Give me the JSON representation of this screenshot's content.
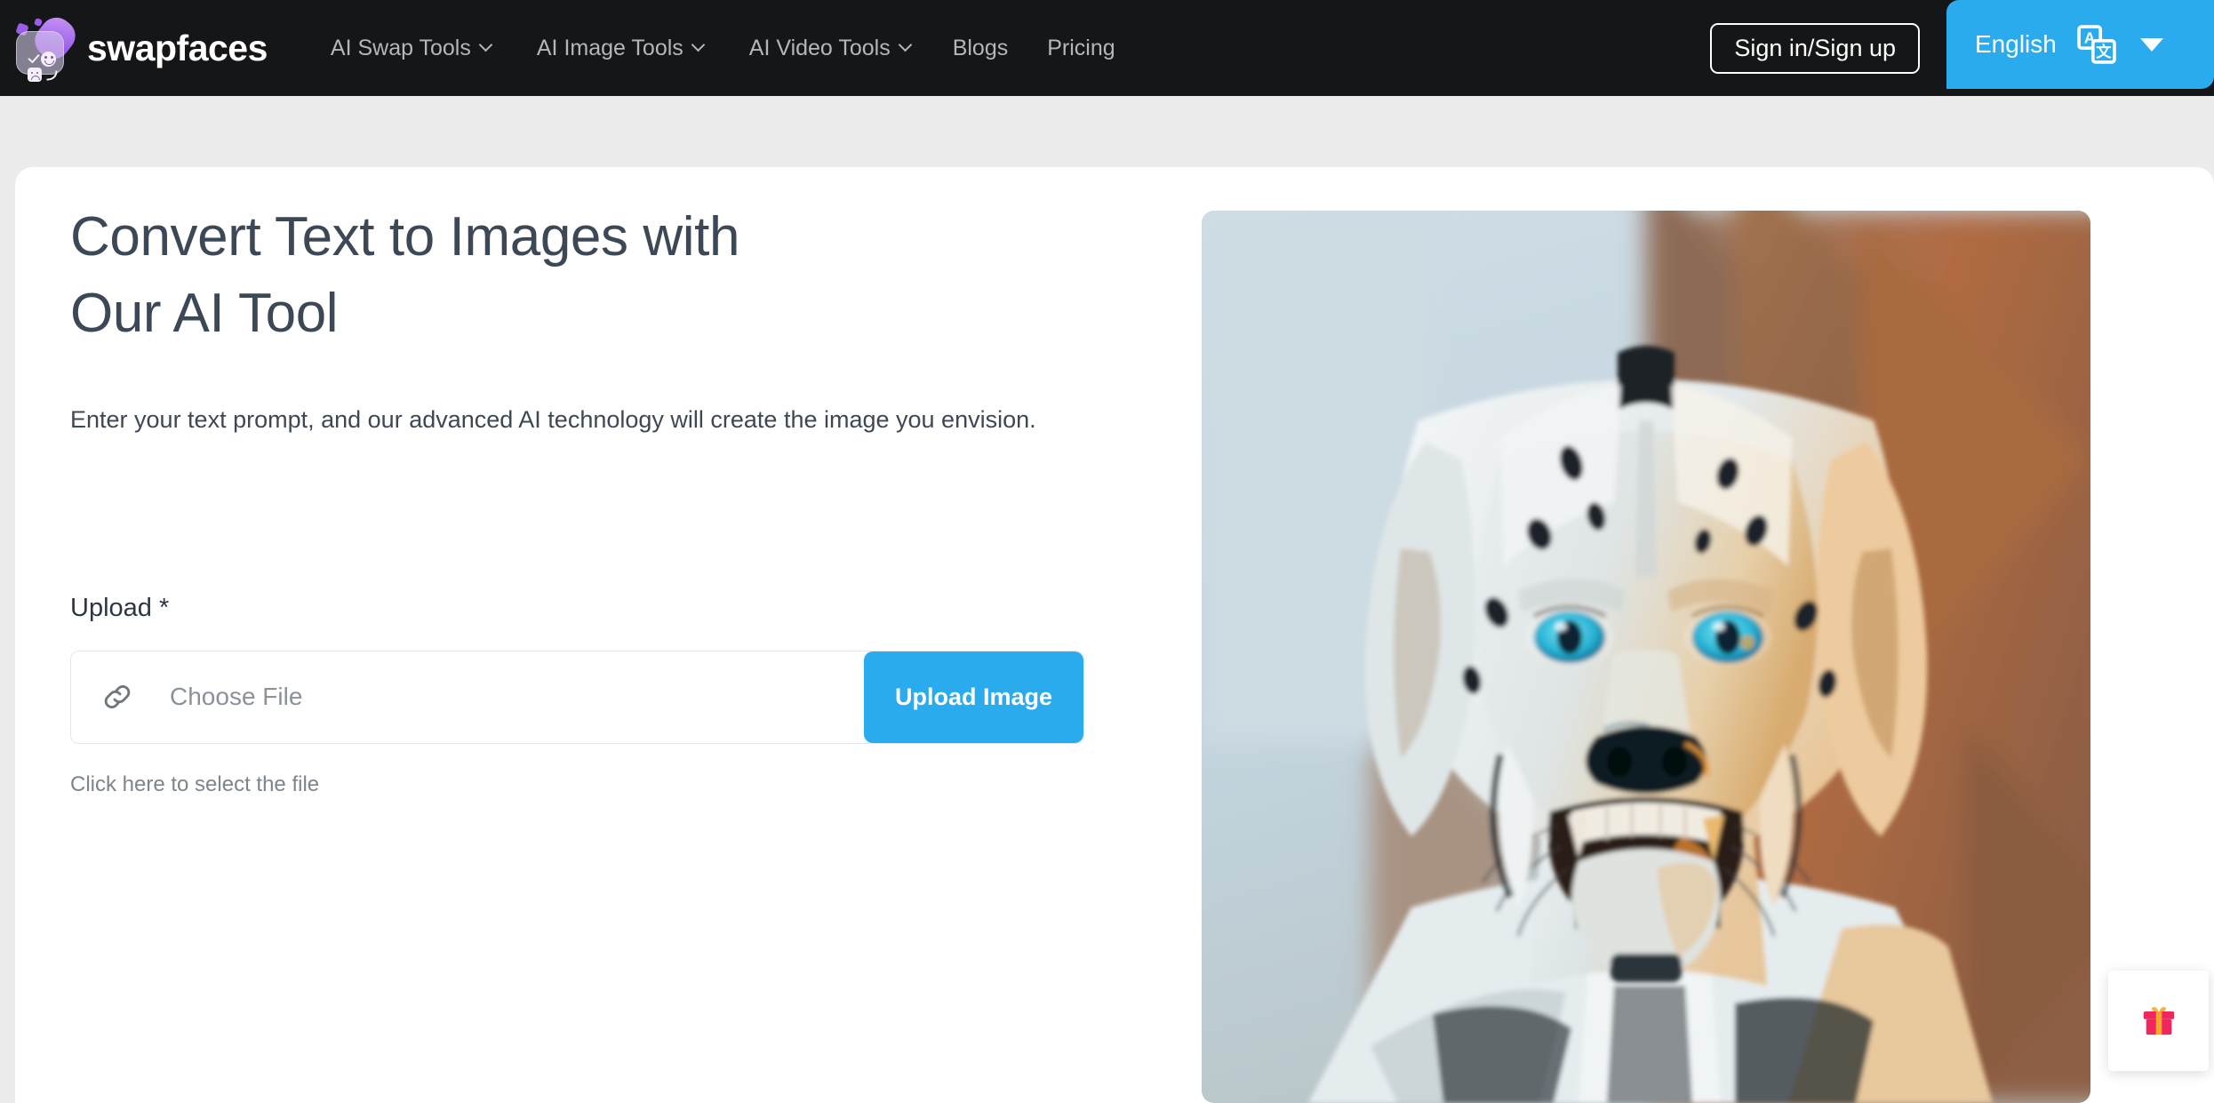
{
  "header": {
    "brand": "swapfaces",
    "nav": [
      {
        "label": "AI Swap Tools",
        "has_dropdown": true
      },
      {
        "label": "AI Image Tools",
        "has_dropdown": true
      },
      {
        "label": "AI Video Tools",
        "has_dropdown": true
      },
      {
        "label": "Blogs",
        "has_dropdown": false
      },
      {
        "label": "Pricing",
        "has_dropdown": false
      }
    ],
    "signin_label": "Sign in/Sign up",
    "language": "English",
    "accent_color": "#29abee",
    "background_color": "#141617"
  },
  "hero": {
    "title_line1": "Convert Text to Images with",
    "title_line2": "Our AI Tool",
    "subtitle": "Enter your text prompt, and our advanced AI technology will create the image you envision."
  },
  "upload": {
    "label": "Upload *",
    "choose_file_text": "Choose File",
    "button_label": "Upload Image",
    "hint": "Click here to select the file"
  },
  "preview": {
    "alt": "robotic cyborg dog with cyan eyes and open mouth"
  },
  "widget": {
    "icon": "gift-icon"
  }
}
